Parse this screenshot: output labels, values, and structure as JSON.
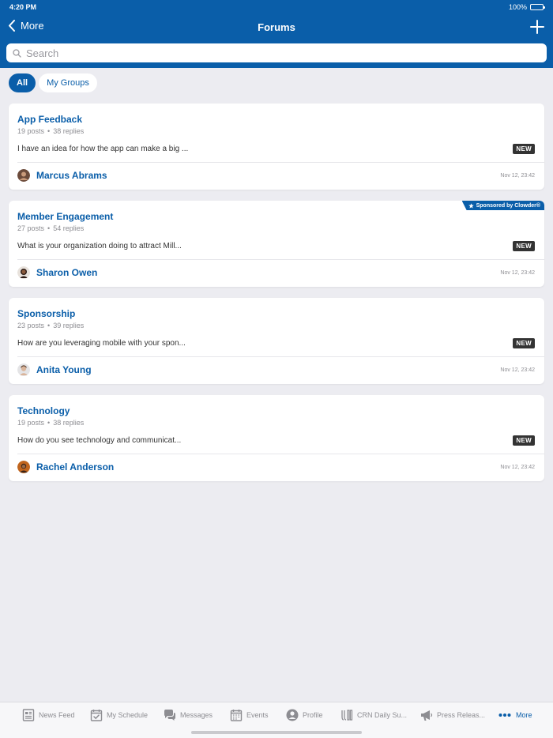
{
  "status_bar": {
    "time": "4:20 PM",
    "battery": "100%"
  },
  "nav": {
    "back_label": "More",
    "title": "Forums"
  },
  "search": {
    "placeholder": "Search"
  },
  "filters": [
    {
      "label": "All",
      "active": true
    },
    {
      "label": "My Groups",
      "active": false
    }
  ],
  "forums": [
    {
      "name": "App Feedback",
      "posts": "19 posts",
      "replies": "38 replies",
      "preview": "I have an idea for how the app can make a big ...",
      "badge": "NEW",
      "author": "Marcus Abrams",
      "time": "Nov 12, 23:42",
      "sponsor": ""
    },
    {
      "name": "Member Engagement",
      "posts": "27 posts",
      "replies": "54 replies",
      "preview": "What is your organization doing to attract Mill...",
      "badge": "NEW",
      "author": "Sharon Owen",
      "time": "Nov 12, 23:42",
      "sponsor": "Sponsored by Clowder®"
    },
    {
      "name": "Sponsorship",
      "posts": "23 posts",
      "replies": "39 replies",
      "preview": "How are you leveraging mobile with your spon...",
      "badge": "NEW",
      "author": "Anita Young",
      "time": "Nov 12, 23:42",
      "sponsor": ""
    },
    {
      "name": "Technology",
      "posts": "19 posts",
      "replies": "38 replies",
      "preview": "How do you see technology and communicat...",
      "badge": "NEW",
      "author": "Rachel Anderson",
      "time": "Nov 12, 23:42",
      "sponsor": ""
    }
  ],
  "tabbar": [
    {
      "label": "News Feed",
      "icon": "news-feed-icon"
    },
    {
      "label": "My Schedule",
      "icon": "calendar-check-icon"
    },
    {
      "label": "Messages",
      "icon": "chat-bubbles-icon"
    },
    {
      "label": "Events",
      "icon": "calendar-icon"
    },
    {
      "label": "Profile",
      "icon": "person-icon"
    },
    {
      "label": "CRN Daily Su...",
      "icon": "daily-icon"
    },
    {
      "label": "Press Releas...",
      "icon": "megaphone-icon"
    },
    {
      "label": "More",
      "icon": "more-dots-icon",
      "active": true
    }
  ],
  "colors": {
    "brand": "#0a5ea9",
    "background": "#ececf1",
    "badge": "#333333"
  }
}
